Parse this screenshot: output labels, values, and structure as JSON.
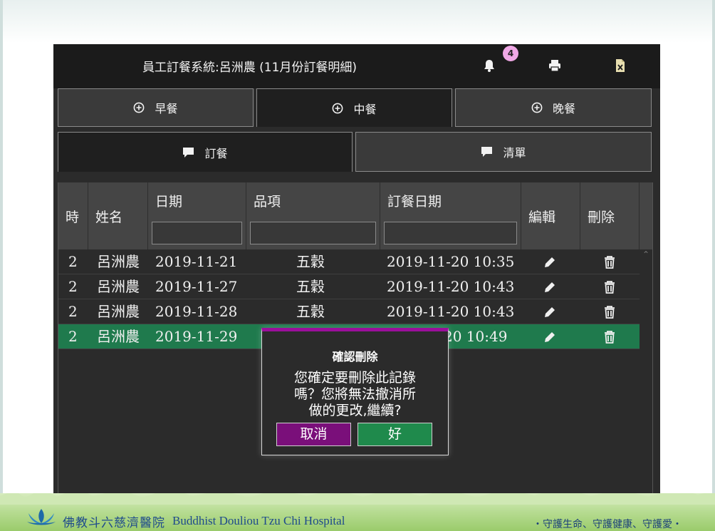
{
  "app": {
    "title": "員工訂餐系統:呂洲農 (11月份訂餐明細)",
    "notification_count": "4"
  },
  "meal_tabs": [
    {
      "label": "早餐",
      "active": false
    },
    {
      "label": "中餐",
      "active": true
    },
    {
      "label": "晚餐",
      "active": false
    }
  ],
  "sub_tabs": [
    {
      "label": "訂餐",
      "active": true
    },
    {
      "label": "清單",
      "active": false
    }
  ],
  "grid": {
    "columns": [
      "時",
      "姓名",
      "日期",
      "品項",
      "訂餐日期",
      "編輯",
      "刪除"
    ],
    "rows": [
      {
        "period": "2",
        "name": "呂洲農",
        "date": "2019-11-21",
        "item": "五穀",
        "order_time": "2019-11-20 10:35"
      },
      {
        "period": "2",
        "name": "呂洲農",
        "date": "2019-11-27",
        "item": "五穀",
        "order_time": "2019-11-20 10:43"
      },
      {
        "period": "2",
        "name": "呂洲農",
        "date": "2019-11-28",
        "item": "五穀",
        "order_time": "2019-11-20 10:43"
      },
      {
        "period": "2",
        "name": "呂洲農",
        "date": "2019-11-29",
        "item": "",
        "order_time": "20 10:49"
      }
    ],
    "selected_row": 3
  },
  "dialog": {
    "title": "確認刪除",
    "message_lines": [
      "您確定要刪除此記錄",
      "嗎？您將無法撤消所",
      "做的更改,繼續?"
    ],
    "cancel_label": "取消",
    "ok_label": "好"
  },
  "footer": {
    "hospital_zh": "佛教斗六慈濟醫院",
    "hospital_en": "Buddhist Douliou Tzu Chi Hospital",
    "motto": "・守護生命、守護健康、守護愛・"
  },
  "colors": {
    "dialog_accent": "#9b0f9b",
    "cancel_button": "#7a0f7a",
    "ok_button": "#1f8a4c",
    "selected_row": "#1f7a4d",
    "badge": "#f0a8e6"
  },
  "icons": [
    "bell-icon",
    "printer-icon",
    "excel-icon",
    "plus-circle-icon",
    "comment-icon",
    "pencil-icon",
    "trash-icon"
  ]
}
